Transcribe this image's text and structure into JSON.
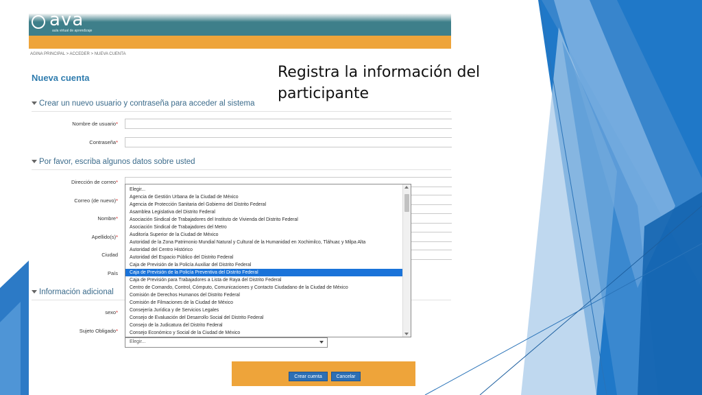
{
  "header": {
    "logo_text": "ava",
    "logo_subtitle": "aula virtual de aprendizaje"
  },
  "breadcrumb": "AGINA PRINCIPAL > ACCEDER > NUEVA CUENTA",
  "page_title": "Nueva cuenta",
  "sections": {
    "account": "Crear un nuevo usuario y contraseña para acceder al sistema",
    "about": "Por favor, escriba algunos datos sobre usted",
    "extra": "Información adicional"
  },
  "fields": {
    "username": "Nombre de usuario",
    "password": "Contraseña",
    "email": "Dirección de correo",
    "email_again": "Correo (de nuevo)",
    "first_name": "Nombre",
    "last_name": "Apellido(s)",
    "city": "Ciudad",
    "country": "País",
    "sex": "sexo",
    "obligated_subject": "Sujeto Obligado"
  },
  "required_mark": "*",
  "dropdown": {
    "selected_index": 11,
    "options": [
      "Elegir...",
      "Agencia de Gestión Urbana de la Ciudad de México",
      "Agencia de Protección Sanitaria del Gobierno del Distrito Federal",
      "Asamblea Legislativa del Distrito Federal",
      "Asociación Sindical de Trabajadores del Instituto de Vivienda del Distrito Federal",
      "Asociación Sindical de Trabajadores del Metro",
      "Auditoría Superior de la Ciudad de México",
      "Autoridad de la Zona Patrimonio Mundial Natural y Cultural de la Humanidad en Xochimilco, Tláhuac y Milpa Alta",
      "Autoridad del Centro Histórico",
      "Autoridad del Espacio Público del Distrito Federal",
      "Caja de Previsión de la Policía Auxiliar del Distrito Federal",
      "Caja de Previsión de la Policía Preventiva del Distrito Federal",
      "Caja de Previsión para Trabajadores a Lista de Raya del Distrito Federal",
      "Centro de Comando, Control, Cómputo, Comunicaciones y Contacto Ciudadano de la Ciudad de México",
      "Comisión de Derechos Humanos del Distrito Federal",
      "Comisión de Filmaciones de la Ciudad de México",
      "Consejería Jurídica y de Servicios Legales",
      "Consejo de Evaluación del Desarrollo Social del Distrito Federal",
      "Consejo de la Judicatura del Distrito Federal",
      "Consejo Económico y Social de la Ciudad de México"
    ]
  },
  "sujeto_select_value": "Elegir...",
  "buttons": {
    "create": "Crear cuenta",
    "cancel": "Cancelar"
  },
  "slide_title": "Registra la información del participante",
  "colors": {
    "header_teal": "#3e7f8a",
    "header_orange": "#eea43a",
    "title_blue": "#2f7cae",
    "selected_option": "#1a73d9",
    "button_blue": "#2d6fb4"
  }
}
